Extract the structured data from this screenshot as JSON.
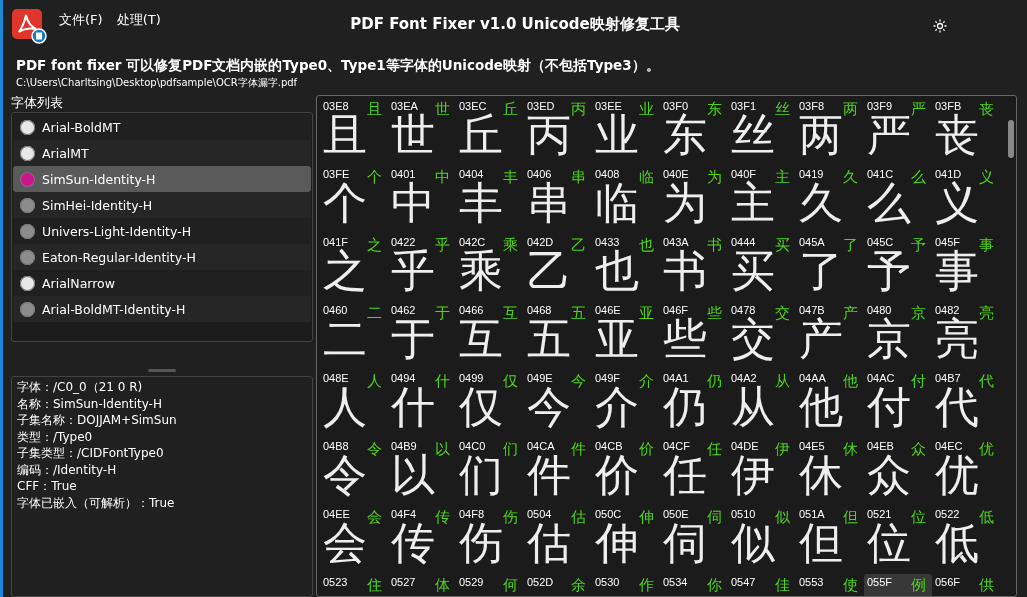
{
  "window": {
    "title": "PDF Font Fixer v1.0  Unicode映射修复工具"
  },
  "menu": [
    "文件(F)",
    "处理(T)"
  ],
  "description": "PDF font fixer 可以修复PDF文档内嵌的Type0、Type1等字体的Unicode映射（不包括Type3）。",
  "file_path": "C:\\Users\\Charltsing\\Desktop\\pdfsample\\OCR字体漏字.pdf",
  "font_list": {
    "label": "字体列表",
    "items": [
      {
        "name": "Arial-BoldMT",
        "color": "#e8e8e8",
        "selected": false
      },
      {
        "name": "ArialMT",
        "color": "#e8e8e8",
        "selected": false
      },
      {
        "name": "SimSun-Identity-H",
        "color": "#c8168c",
        "selected": true
      },
      {
        "name": "SimHei-Identity-H",
        "color": "#8c8c8c",
        "selected": false
      },
      {
        "name": "Univers-Light-Identity-H",
        "color": "#8c8c8c",
        "selected": false
      },
      {
        "name": "Eaton-Regular-Identity-H",
        "color": "#8c8c8c",
        "selected": false
      },
      {
        "name": "ArialNarrow",
        "color": "#e8e8e8",
        "selected": false
      },
      {
        "name": "Arial-BoldMT-Identity-H",
        "color": "#8c8c8c",
        "selected": false
      }
    ]
  },
  "font_info": [
    "字体：/C0_0（21 0 R)",
    "名称：SimSun-Identity-H",
    "子集名称：DOJJAM+SimSun",
    "类型：/Type0",
    "子集类型：/CIDFontType0",
    "编码：/Identity-H",
    "CFF：True",
    "字体已嵌入（可解析）：True"
  ],
  "glyph_rows": [
    [
      {
        "code": "03E8",
        "char": "且",
        "glyph": "且",
        "selected": false
      },
      {
        "code": "03EA",
        "char": "世",
        "glyph": "世",
        "selected": false
      },
      {
        "code": "03EC",
        "char": "丘",
        "glyph": "丘",
        "selected": false
      },
      {
        "code": "03ED",
        "char": "丙",
        "glyph": "丙",
        "selected": false
      },
      {
        "code": "03EE",
        "char": "业",
        "glyph": "业",
        "selected": false
      },
      {
        "code": "03F0",
        "char": "东",
        "glyph": "东",
        "selected": false
      },
      {
        "code": "03F1",
        "char": "丝",
        "glyph": "丝",
        "selected": false
      },
      {
        "code": "03F8",
        "char": "两",
        "glyph": "两",
        "selected": false
      },
      {
        "code": "03F9",
        "char": "严",
        "glyph": "严",
        "selected": false
      },
      {
        "code": "03FB",
        "char": "丧",
        "glyph": "丧",
        "selected": false
      }
    ],
    [
      {
        "code": "03FE",
        "char": "个",
        "glyph": "个",
        "selected": false
      },
      {
        "code": "0401",
        "char": "中",
        "glyph": "中",
        "selected": false
      },
      {
        "code": "0404",
        "char": "丰",
        "glyph": "丰",
        "selected": false
      },
      {
        "code": "0406",
        "char": "串",
        "glyph": "串",
        "selected": false
      },
      {
        "code": "0408",
        "char": "临",
        "glyph": "临",
        "selected": false
      },
      {
        "code": "040E",
        "char": "为",
        "glyph": "为",
        "selected": false
      },
      {
        "code": "040F",
        "char": "主",
        "glyph": "主",
        "selected": false
      },
      {
        "code": "0419",
        "char": "久",
        "glyph": "久",
        "selected": false
      },
      {
        "code": "041C",
        "char": "么",
        "glyph": "么",
        "selected": false
      },
      {
        "code": "041D",
        "char": "义",
        "glyph": "义",
        "selected": false
      }
    ],
    [
      {
        "code": "041F",
        "char": "之",
        "glyph": "之",
        "selected": false
      },
      {
        "code": "0422",
        "char": "乎",
        "glyph": "乎",
        "selected": false
      },
      {
        "code": "042C",
        "char": "乘",
        "glyph": "乘",
        "selected": false
      },
      {
        "code": "042D",
        "char": "乙",
        "glyph": "乙",
        "selected": false
      },
      {
        "code": "0433",
        "char": "也",
        "glyph": "也",
        "selected": false
      },
      {
        "code": "043A",
        "char": "书",
        "glyph": "书",
        "selected": false
      },
      {
        "code": "0444",
        "char": "买",
        "glyph": "买",
        "selected": false
      },
      {
        "code": "045A",
        "char": "了",
        "glyph": "了",
        "selected": false
      },
      {
        "code": "045C",
        "char": "予",
        "glyph": "予",
        "selected": false
      },
      {
        "code": "045F",
        "char": "事",
        "glyph": "事",
        "selected": false
      }
    ],
    [
      {
        "code": "0460",
        "char": "二",
        "glyph": "二",
        "selected": false
      },
      {
        "code": "0462",
        "char": "于",
        "glyph": "于",
        "selected": false
      },
      {
        "code": "0466",
        "char": "互",
        "glyph": "互",
        "selected": false
      },
      {
        "code": "0468",
        "char": "五",
        "glyph": "五",
        "selected": false
      },
      {
        "code": "046E",
        "char": "亚",
        "glyph": "亚",
        "selected": false
      },
      {
        "code": "046F",
        "char": "些",
        "glyph": "些",
        "selected": false
      },
      {
        "code": "0478",
        "char": "交",
        "glyph": "交",
        "selected": false
      },
      {
        "code": "047B",
        "char": "产",
        "glyph": "产",
        "selected": false
      },
      {
        "code": "0480",
        "char": "京",
        "glyph": "京",
        "selected": false
      },
      {
        "code": "0482",
        "char": "亮",
        "glyph": "亮",
        "selected": false
      }
    ],
    [
      {
        "code": "048E",
        "char": "人",
        "glyph": "人",
        "selected": false
      },
      {
        "code": "0494",
        "char": "什",
        "glyph": "什",
        "selected": false
      },
      {
        "code": "0499",
        "char": "仅",
        "glyph": "仅",
        "selected": false
      },
      {
        "code": "049E",
        "char": "今",
        "glyph": "今",
        "selected": false
      },
      {
        "code": "049F",
        "char": "介",
        "glyph": "介",
        "selected": false
      },
      {
        "code": "04A1",
        "char": "仍",
        "glyph": "仍",
        "selected": false
      },
      {
        "code": "04A2",
        "char": "从",
        "glyph": "从",
        "selected": false
      },
      {
        "code": "04AA",
        "char": "他",
        "glyph": "他",
        "selected": false
      },
      {
        "code": "04AC",
        "char": "付",
        "glyph": "付",
        "selected": false
      },
      {
        "code": "04B7",
        "char": "代",
        "glyph": "代",
        "selected": false
      }
    ],
    [
      {
        "code": "04B8",
        "char": "令",
        "glyph": "令",
        "selected": false
      },
      {
        "code": "04B9",
        "char": "以",
        "glyph": "以",
        "selected": false
      },
      {
        "code": "04C0",
        "char": "们",
        "glyph": "们",
        "selected": false
      },
      {
        "code": "04CA",
        "char": "件",
        "glyph": "件",
        "selected": false
      },
      {
        "code": "04CB",
        "char": "价",
        "glyph": "价",
        "selected": false
      },
      {
        "code": "04CF",
        "char": "任",
        "glyph": "任",
        "selected": false
      },
      {
        "code": "04DE",
        "char": "伊",
        "glyph": "伊",
        "selected": false
      },
      {
        "code": "04E5",
        "char": "休",
        "glyph": "休",
        "selected": false
      },
      {
        "code": "04EB",
        "char": "众",
        "glyph": "众",
        "selected": false
      },
      {
        "code": "04EC",
        "char": "优",
        "glyph": "优",
        "selected": false
      }
    ],
    [
      {
        "code": "04EE",
        "char": "会",
        "glyph": "会",
        "selected": false
      },
      {
        "code": "04F4",
        "char": "传",
        "glyph": "传",
        "selected": false
      },
      {
        "code": "04F8",
        "char": "伤",
        "glyph": "伤",
        "selected": false
      },
      {
        "code": "0504",
        "char": "估",
        "glyph": "估",
        "selected": false
      },
      {
        "code": "050C",
        "char": "伸",
        "glyph": "伸",
        "selected": false
      },
      {
        "code": "050E",
        "char": "伺",
        "glyph": "伺",
        "selected": false
      },
      {
        "code": "0510",
        "char": "似",
        "glyph": "似",
        "selected": false
      },
      {
        "code": "051A",
        "char": "但",
        "glyph": "但",
        "selected": false
      },
      {
        "code": "0521",
        "char": "位",
        "glyph": "位",
        "selected": false
      },
      {
        "code": "0522",
        "char": "低",
        "glyph": "低",
        "selected": false
      }
    ],
    [
      {
        "code": "0523",
        "char": "住",
        "selected": false
      },
      {
        "code": "0527",
        "char": "体",
        "selected": false
      },
      {
        "code": "0529",
        "char": "何",
        "selected": false
      },
      {
        "code": "052D",
        "char": "余",
        "selected": false
      },
      {
        "code": "0530",
        "char": "作",
        "selected": false
      },
      {
        "code": "0534",
        "char": "你",
        "selected": false
      },
      {
        "code": "0547",
        "char": "佳",
        "selected": false
      },
      {
        "code": "0553",
        "char": "使",
        "selected": false
      },
      {
        "code": "055F",
        "char": "例",
        "selected": true
      },
      {
        "code": "056F",
        "char": "供",
        "selected": false
      }
    ]
  ]
}
